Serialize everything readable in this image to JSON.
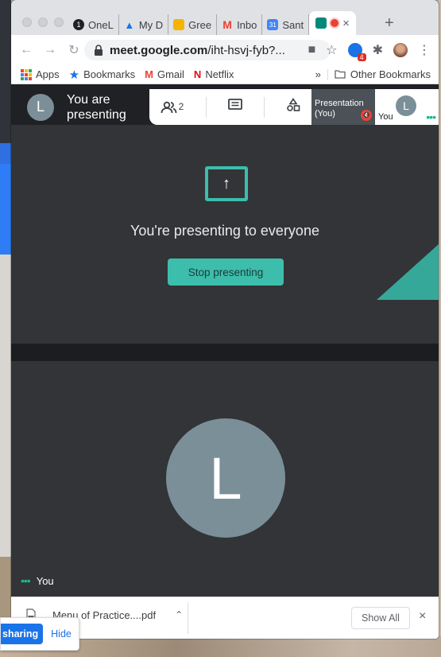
{
  "tabs": [
    {
      "label": "OneL",
      "favicon": "1",
      "favicon_color": "#202124"
    },
    {
      "label": "My D",
      "favicon": "▲",
      "favicon_color": "#1a73e8"
    },
    {
      "label": "Gree",
      "favicon": "▬",
      "favicon_color": "#f4b400"
    },
    {
      "label": "Inbo",
      "favicon": "M",
      "favicon_color": "#ea4335"
    },
    {
      "label": "Sant",
      "favicon": "31",
      "favicon_color": "#4285f4"
    }
  ],
  "active_tab": {
    "label": "",
    "close": "×",
    "recording_color": "#ea4335"
  },
  "new_tab_symbol": "+",
  "toolbar": {
    "back": "←",
    "forward": "→",
    "reload": "↻",
    "url_host": "meet.google.com",
    "url_path": "/iht-hsvj-fyb?...",
    "camera_icon": "■",
    "star_icon": "☆",
    "puzzle_icon": "✱",
    "menu_icon": "⋮",
    "extension_badge": "4"
  },
  "bookmarks": {
    "apps": "Apps",
    "bookmarks": "Bookmarks",
    "gmail": "Gmail",
    "netflix": "Netflix",
    "overflow": "»",
    "other": "Other Bookmarks"
  },
  "meet_header": {
    "avatar_letter": "L",
    "presenting_line1": "You are",
    "presenting_line2": "presenting",
    "people_count": "2",
    "presentation_label": "Presentation (You)",
    "you_label": "You",
    "you_avatar_letter": "L"
  },
  "presenting": {
    "message": "You're presenting to everyone",
    "stop_button": "Stop presenting"
  },
  "self_tile": {
    "avatar_letter": "L",
    "label": "You"
  },
  "downloads": {
    "file_name": "Menu of Practice....pdf",
    "show_all": "Show All",
    "close": "×"
  },
  "share_notification": {
    "stop_label": "sharing",
    "hide_label": "Hide"
  },
  "colors": {
    "accent_teal": "#3dbdac",
    "avatar": "#7b8f99",
    "meet_dark": "#202124"
  }
}
